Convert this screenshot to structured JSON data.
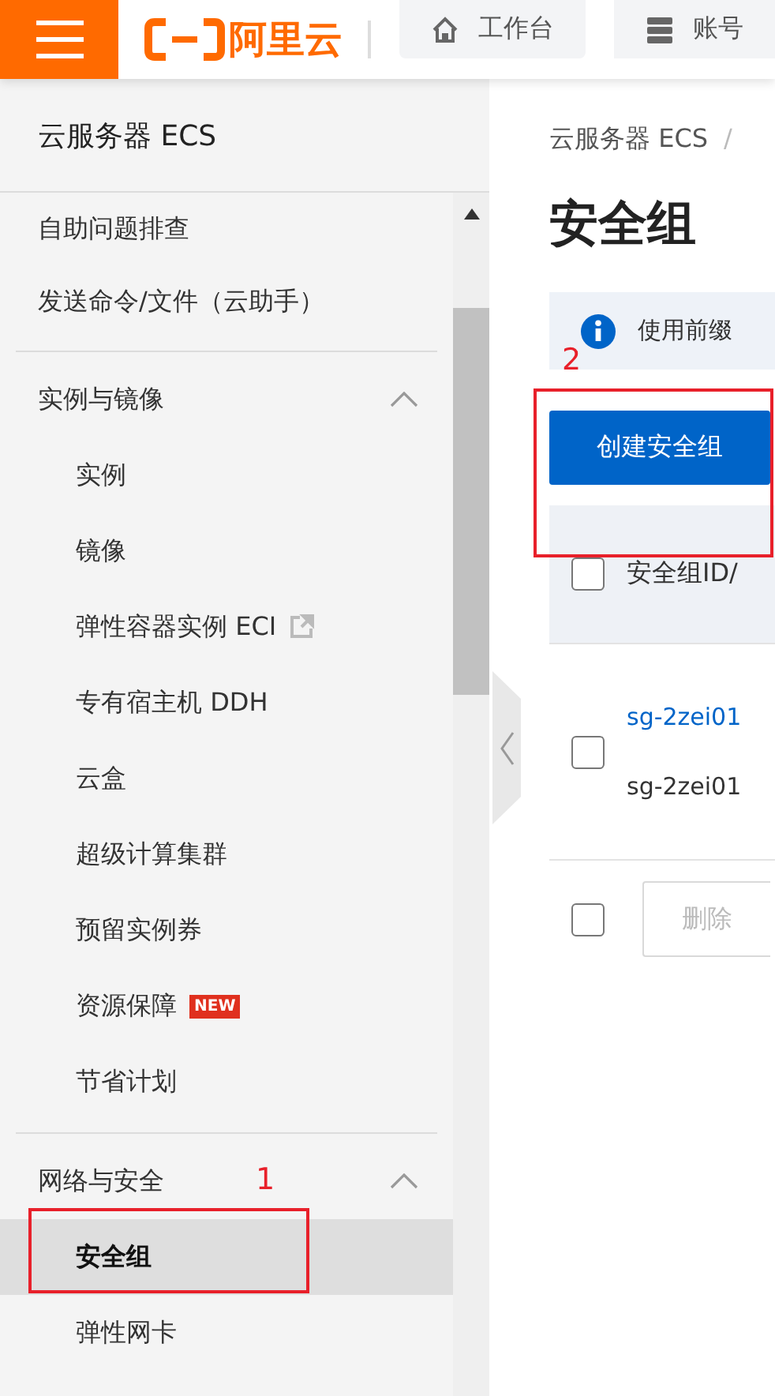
{
  "topbar": {
    "logo_text": "阿里云",
    "tabs": [
      {
        "label": "工作台",
        "kind": "home"
      },
      {
        "label": "账号",
        "kind": "server"
      }
    ]
  },
  "sidebar": {
    "title": "云服务器 ECS",
    "sections": [
      {
        "kind": "items",
        "items": [
          {
            "label": "自助问题排查",
            "selected": false
          },
          {
            "label": "发送命令/文件（云助手）",
            "selected": false
          }
        ]
      },
      {
        "kind": "group",
        "label": "实例与镜像",
        "expanded": true,
        "items": [
          {
            "label": "实例",
            "selected": false
          },
          {
            "label": "镜像",
            "selected": false
          },
          {
            "label": "弹性容器实例 ECI",
            "selected": false,
            "external": true
          },
          {
            "label": "专有宿主机 DDH",
            "selected": false
          },
          {
            "label": "云盒",
            "selected": false
          },
          {
            "label": "超级计算集群",
            "selected": false
          },
          {
            "label": "预留实例券",
            "selected": false
          },
          {
            "label": "资源保障",
            "selected": false,
            "badge": "NEW"
          },
          {
            "label": "节省计划",
            "selected": false
          }
        ]
      },
      {
        "kind": "group",
        "label": "网络与安全",
        "expanded": true,
        "items": [
          {
            "label": "安全组",
            "selected": true
          },
          {
            "label": "弹性网卡",
            "selected": false
          }
        ]
      }
    ]
  },
  "main": {
    "breadcrumb": {
      "items": [
        "云服务器 ECS"
      ],
      "separator": "/"
    },
    "title": "安全组",
    "notice": "使用前缀",
    "create_button": "创建安全组",
    "table": {
      "select_all": false,
      "columns": [
        "安全组ID/"
      ],
      "rows": [
        {
          "selected": false,
          "id": "sg-2zei01",
          "name": "sg-2zei01"
        }
      ]
    },
    "footer": {
      "select_all": false,
      "delete_button": {
        "label": "删除",
        "disabled": true
      }
    }
  },
  "annotations": [
    {
      "label": "1"
    },
    {
      "label": "2"
    }
  ]
}
